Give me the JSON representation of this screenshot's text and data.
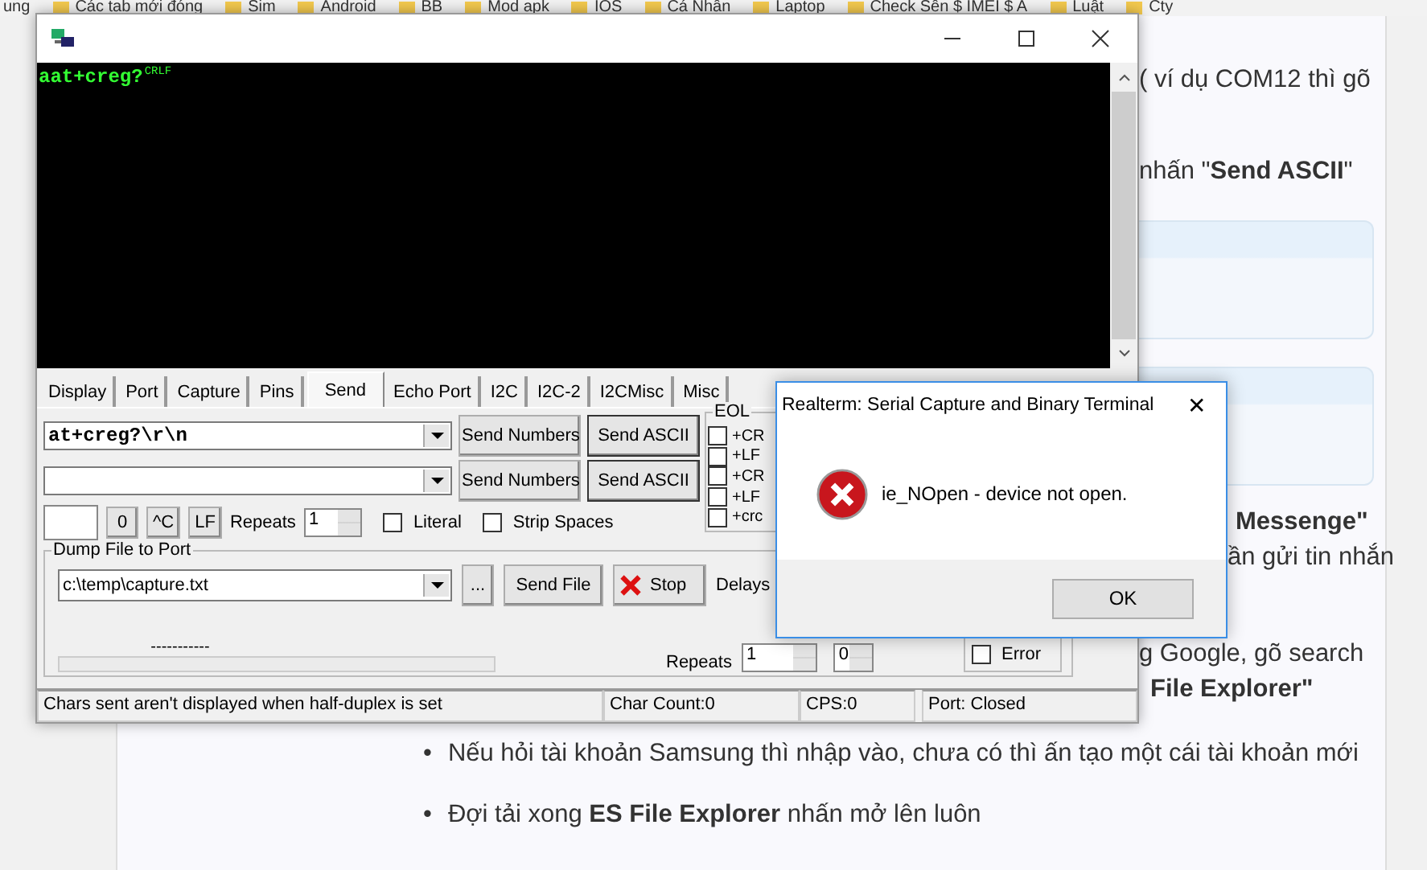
{
  "bookmarks": [
    "ung",
    "Các tab mới đóng",
    "Sim",
    "Android",
    "BB",
    "Mod apk",
    "IOS",
    "Cá Nhân",
    "Laptop",
    "Check Sên $ IMEI $ A",
    "Luật",
    "Cty"
  ],
  "article": {
    "lines": [
      {
        "text": "( ví dụ COM12 thì gõ",
        "bold": false
      },
      {
        "text": "nhấn \"**Send ASCII**\"",
        "bold": false
      },
      {
        "text": "Messenge\"",
        "bold": true
      },
      {
        "text": "ần gửi tin nhắn",
        "bold": false
      },
      {
        "text": "g Google, gõ search",
        "bold": false
      },
      {
        "text": "File Explorer\"",
        "bold": true
      }
    ],
    "bullet_marker": "•",
    "bullets": [
      "Nếu hỏi tài khoản Samsung thì nhập vào, chưa có thì ấn tạo một cái tài khoản mới",
      "Đợi tải xong **ES File Explorer** nhấn mở lên luôn"
    ]
  },
  "realterm": {
    "terminal": {
      "text": "aat+creg?",
      "eol_mark": "CRLF"
    },
    "tabs": [
      {
        "label": "Display",
        "selected": false
      },
      {
        "label": "Port",
        "selected": false
      },
      {
        "label": "Capture",
        "selected": false
      },
      {
        "label": "Pins",
        "selected": false
      },
      {
        "label": "Send",
        "selected": true
      },
      {
        "label": "Echo Port",
        "selected": false
      },
      {
        "label": "I2C",
        "selected": false
      },
      {
        "label": "I2C-2",
        "selected": false
      },
      {
        "label": "I2CMisc",
        "selected": false
      },
      {
        "label": "Misc",
        "selected": false
      }
    ],
    "send_rows": [
      {
        "value": "at+creg?\\r\\n",
        "numbers_button": "Send Numbers",
        "ascii_button": "Send ASCII"
      },
      {
        "value": "",
        "numbers_button": "Send Numbers",
        "ascii_button": "Send ASCII"
      }
    ],
    "quick_buttons": [
      "0",
      "^C",
      "LF"
    ],
    "repeats": {
      "label": "Repeats",
      "value": "1"
    },
    "options": [
      {
        "label": "Literal",
        "checked": false
      },
      {
        "label": "Strip Spaces",
        "checked": false
      }
    ],
    "eol": {
      "title": "EOL",
      "items": [
        {
          "label": "+CR",
          "checked": false
        },
        {
          "label": "+LF",
          "checked": false
        },
        {
          "label": "+CR",
          "checked": false
        },
        {
          "label": "+LF",
          "checked": false
        },
        {
          "label": "+crc",
          "checked": false
        }
      ]
    },
    "dump": {
      "title": "Dump File to Port",
      "file": "c:\\temp\\capture.txt",
      "browse": "...",
      "send_file": "Send File",
      "stop": "Stop",
      "delays": "Delays",
      "progress_text": "-----------",
      "progress": {
        "level": 0
      },
      "repeats_label": "Repeats",
      "repeats": "1",
      "delay_value": "0",
      "error": {
        "label": "Error",
        "checked": false
      }
    },
    "status": [
      "Chars sent aren't displayed when half-duplex is set",
      "Char Count:0",
      "CPS:0",
      "Port: Closed"
    ]
  },
  "dialog": {
    "title": "Realterm: Serial Capture and Binary Terminal",
    "close": "✕",
    "message": "ie_NOpen - device not open.",
    "ok": "OK"
  }
}
